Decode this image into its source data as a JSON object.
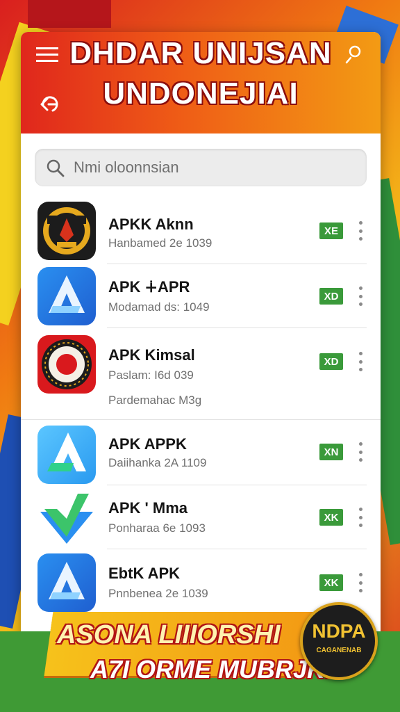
{
  "header": {
    "title_line1": "DHDAR UNIJSAN",
    "title_line2": "UNDONEJIAI",
    "menu_icon": "menu-icon",
    "back_icon": "back-icon",
    "user_icon": "user-icon"
  },
  "search": {
    "placeholder": "Nmi oloonnsian",
    "icon": "search-icon"
  },
  "apps": [
    {
      "name": "APKK Aknn",
      "meta": "Hanbamed 2e 1039",
      "meta2": "",
      "badge": "XE",
      "icon": "emblem-red-circle"
    },
    {
      "name": "APK ∔APR",
      "meta": "Modamad ds: 1049",
      "meta2": "",
      "badge": "XD",
      "icon": "blue-a-logo"
    },
    {
      "name": "APK Kimsal",
      "meta": "Paslam: I6d 039",
      "meta2": "Pardemahac M3g",
      "badge": "XD",
      "icon": "red-ring-emblem"
    },
    {
      "name": "APK APPK",
      "meta": "Daiihanka 2A 1109",
      "meta2": "",
      "badge": "XN",
      "icon": "light-blue-a-logo"
    },
    {
      "name": "APK ' Mma",
      "meta": "Ponharaa 6e 1093",
      "meta2": "",
      "badge": "XK",
      "icon": "green-v-logo"
    },
    {
      "name": "EbtK APK",
      "meta": "Pnnbenea 2e 1039",
      "meta2": "",
      "badge": "XK",
      "icon": "blue-a-logo"
    }
  ],
  "banner": {
    "line1": "ASONA LIIIORSHI",
    "line2": "A7I ORME MUBRJK!",
    "seal_line1": "NDPA",
    "seal_line2": "CAGANENAB"
  },
  "colors": {
    "header_start": "#e0271c",
    "header_end": "#f39b14",
    "badge_green": "#3a9a3a",
    "banner_yellow": "#f6c21b",
    "banner_green": "#3f9a35"
  }
}
